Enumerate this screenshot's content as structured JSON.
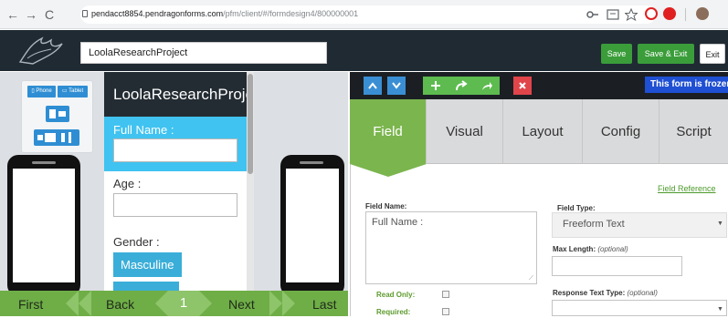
{
  "browser": {
    "url_host": "pendacct8854.pendragonforms.com",
    "url_path": "/pfm/client/#/formdesign4/800000001",
    "back_glyph": "←",
    "forward_glyph": "→",
    "reload_glyph": "C"
  },
  "header": {
    "project_name": "LoolaResearchProject",
    "save_label": "Save",
    "save_exit_label": "Save & Exit",
    "exit_label": "Exit",
    "colors": {
      "header_bg": "#1f2a33",
      "save_green": "#3a9d3a"
    }
  },
  "device_toggle": {
    "phone_label": "Phone",
    "tablet_label": "Tablet"
  },
  "form_preview": {
    "title": "LoolaResearchProject",
    "fields": [
      {
        "label": "Full Name :"
      },
      {
        "label": "Age :"
      },
      {
        "label": "Gender :"
      }
    ],
    "options": [
      "Masculine"
    ]
  },
  "bottom_nav": {
    "first": "First",
    "back": "Back",
    "page": "1",
    "next": "Next",
    "last": "Last"
  },
  "toolbar": {
    "up_icon": "up-chevron-icon",
    "down_icon": "down-chevron-icon",
    "add_icon": "plus-icon",
    "redo_icon": "redo-icon",
    "share_icon": "share-icon",
    "delete_icon": "x-icon",
    "frozen_message": "This form is frozen"
  },
  "tabs": [
    {
      "label": "Field",
      "active": true
    },
    {
      "label": "Visual",
      "active": false
    },
    {
      "label": "Layout",
      "active": false
    },
    {
      "label": "Config",
      "active": false
    },
    {
      "label": "Script",
      "active": false
    }
  ],
  "field_panel": {
    "field_reference": "Field Reference",
    "field_name_label": "Field Name:",
    "field_name_value": "Full Name :",
    "field_type_label": "Field Type:",
    "field_type_value": "Freeform Text",
    "max_length_label": "Max Length:",
    "max_length_optional": "(optional)",
    "response_text_type_label": "Response Text Type:",
    "response_text_type_optional": "(optional)",
    "read_only_label": "Read Only:",
    "required_label": "Required:"
  }
}
